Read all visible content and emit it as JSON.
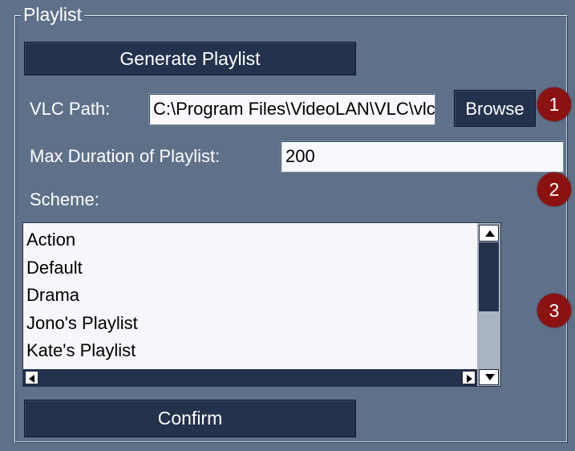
{
  "panel": {
    "legend": "Playlist"
  },
  "generate_button": {
    "label": "Generate Playlist"
  },
  "vlc_path": {
    "label": "VLC Path:",
    "value": "C:\\Program Files\\VideoLAN\\VLC\\vlc.exe",
    "browse_label": "Browse"
  },
  "max_duration": {
    "label": "Max Duration of Playlist:",
    "value": "200"
  },
  "scheme": {
    "label": "Scheme:",
    "items": [
      "Action",
      "Default",
      "Drama",
      "Jono's Playlist",
      "Kate's Playlist"
    ]
  },
  "confirm_button": {
    "label": "Confirm"
  },
  "callouts": [
    "1",
    "2",
    "3"
  ],
  "colors": {
    "background": "#5f7189",
    "button": "#24324d",
    "callout": "#8c1111",
    "text": "#ffffff"
  }
}
